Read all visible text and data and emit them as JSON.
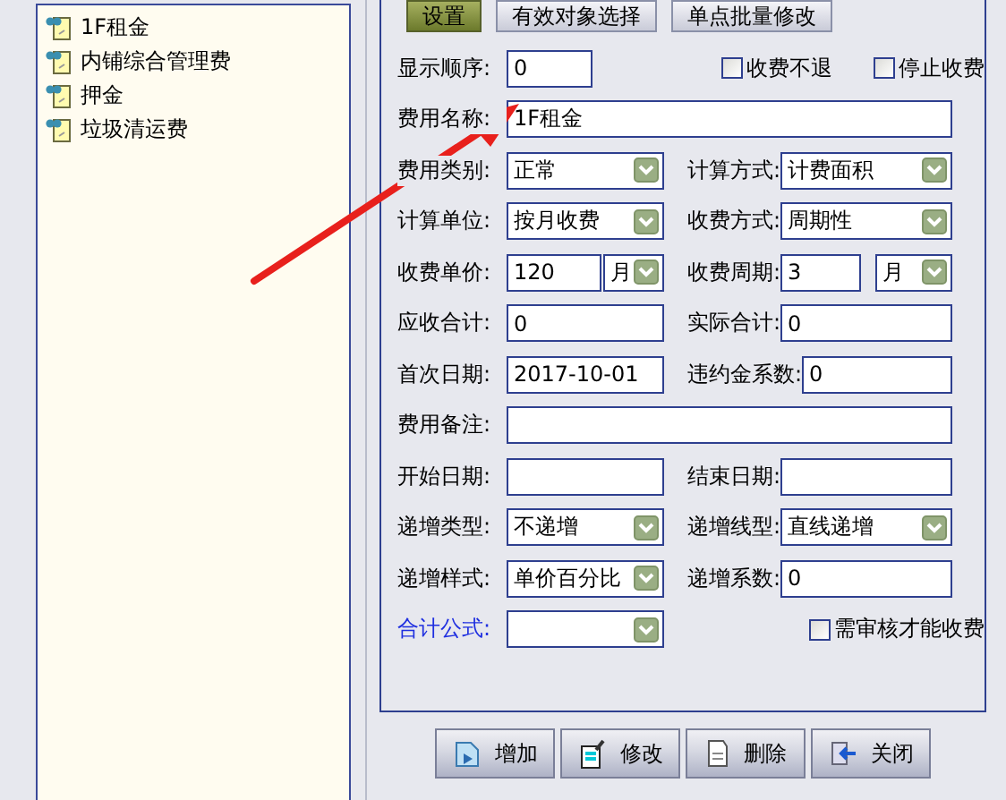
{
  "tree": {
    "items": [
      {
        "label": "1F租金",
        "selected": false
      },
      {
        "label": "内铺综合管理费",
        "selected": false
      },
      {
        "label": "押金",
        "selected": false
      },
      {
        "label": "垃圾清运费",
        "selected": false
      }
    ]
  },
  "tabs": [
    {
      "label": "设置",
      "selected": true
    },
    {
      "label": "有效对象选择",
      "selected": false
    },
    {
      "label": "单点批量修改",
      "selected": false
    }
  ],
  "form": {
    "rows": [
      [
        {
          "kind": "short",
          "label": "显示顺序:",
          "value": "0",
          "linked": false
        },
        {
          "kind": "check",
          "label": "收费不退",
          "checked": false
        },
        {
          "kind": "check",
          "label": "停止收费",
          "checked": false
        }
      ],
      [
        {
          "kind": "wide",
          "label": "费用名称:",
          "value": "1F租金",
          "linked": false
        }
      ],
      [
        {
          "kind": "combo",
          "label": "费用类别:",
          "value": "正常",
          "linked": false
        },
        {
          "kind": "combo",
          "label": "计算方式:",
          "value": "计费面积",
          "linked": false
        }
      ],
      [
        {
          "kind": "combo",
          "label": "计算单位:",
          "value": "按月收费",
          "linked": false
        },
        {
          "kind": "combo",
          "label": "收费方式:",
          "value": "周期性",
          "linked": false
        }
      ],
      [
        {
          "kind": "price",
          "label": "收费单价:",
          "value": "120",
          "unit": "月",
          "linked": false
        },
        {
          "kind": "price",
          "label": "收费周期:",
          "value": "3",
          "unit": "月",
          "linked": false
        }
      ],
      [
        {
          "kind": "text",
          "label": "应收合计:",
          "value": "0",
          "linked": false
        },
        {
          "kind": "text",
          "label": "实际合计:",
          "value": "0",
          "linked": false
        }
      ],
      [
        {
          "kind": "text",
          "label": "首次日期:",
          "value": "2017-10-01",
          "linked": false
        },
        {
          "kind": "text",
          "label": "违约金系数:",
          "value": "0",
          "linked": false
        }
      ],
      [
        {
          "kind": "wide",
          "label": "费用备注:",
          "linked": false
        }
      ],
      [
        {
          "kind": "text",
          "label": "开始日期:",
          "linked": false
        },
        {
          "kind": "text",
          "label": "结束日期:",
          "linked": false
        }
      ],
      [
        {
          "kind": "combo",
          "label": "递增类型:",
          "value": "不递增",
          "linked": false
        },
        {
          "kind": "combo",
          "label": "递增线型:",
          "value": "直线递增",
          "linked": false
        }
      ],
      [
        {
          "kind": "combo",
          "label": "递增样式:",
          "value": "单价百分比",
          "linked": false
        },
        {
          "kind": "text",
          "label": "递增系数:",
          "value": "0",
          "linked": false
        }
      ],
      [
        {
          "kind": "combo",
          "label": "合计公式:",
          "linked": true
        },
        {
          "kind": "check",
          "label": "需审核才能收费",
          "checked": false
        }
      ]
    ]
  },
  "buttons": [
    {
      "label": "增加",
      "kind": "add"
    },
    {
      "label": "修改",
      "kind": "edit"
    },
    {
      "label": "删除",
      "kind": "delete"
    },
    {
      "label": "关闭",
      "kind": "close"
    }
  ]
}
